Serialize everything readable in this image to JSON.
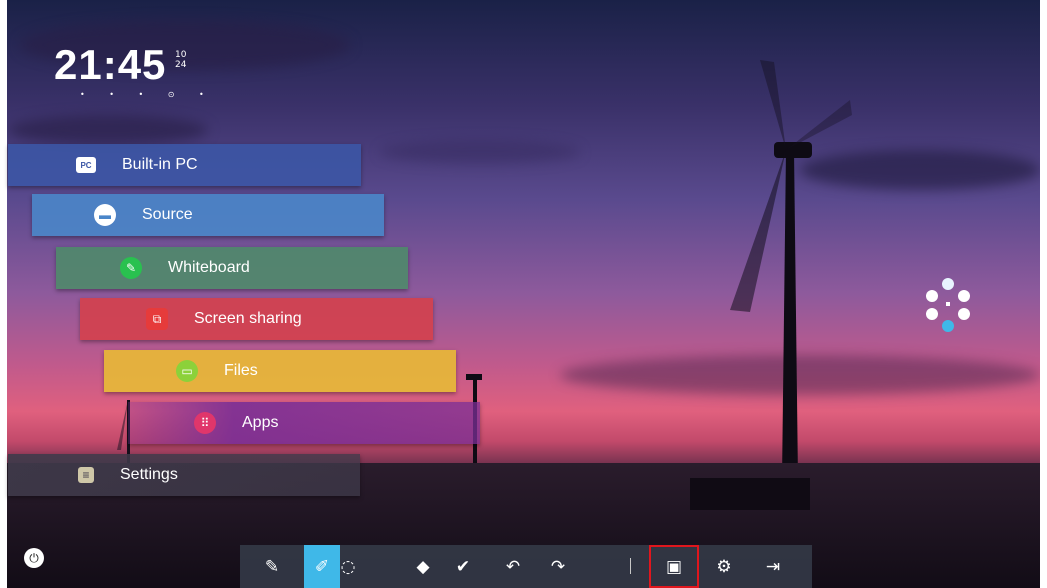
{
  "clock": {
    "time": "21:45",
    "date_top": "10",
    "date_bottom": "24"
  },
  "page_dots": "• • • ⊙ •",
  "menu": [
    {
      "label": "Built-in PC",
      "icon": "pc-icon"
    },
    {
      "label": "Source",
      "icon": "source-icon"
    },
    {
      "label": "Whiteboard",
      "icon": "whiteboard-icon"
    },
    {
      "label": "Screen sharing",
      "icon": "screen-sharing-icon"
    },
    {
      "label": "Files",
      "icon": "files-icon"
    },
    {
      "label": "Apps",
      "icon": "apps-icon"
    },
    {
      "label": "Settings",
      "icon": "settings-icon"
    }
  ],
  "menu_icon_glyphs": {
    "pc": "PC",
    "source": "▬",
    "whiteboard": "✎",
    "screen": "⧉",
    "files": "▭",
    "apps": "⠿",
    "settings": "≡"
  },
  "colors": {
    "built_in_pc": "#3b57a6",
    "source": "#4a86c9",
    "whiteboard": "#4f8a6a",
    "screen_sharing": "#d2414e",
    "files": "#e6b53a",
    "apps": "#7a2e95",
    "settings": "#3f3a4a",
    "toolbar_active": "#3fb8e8",
    "selection_outline": "#e0161d"
  },
  "toolbar": {
    "tools": [
      {
        "name": "pen",
        "glyph": "✎"
      },
      {
        "name": "highlighter",
        "glyph": "✐"
      },
      {
        "name": "lasso",
        "glyph": "◌"
      },
      {
        "name": "eraser",
        "glyph": "◆"
      },
      {
        "name": "check",
        "glyph": "✔"
      },
      {
        "name": "undo",
        "glyph": "↶"
      },
      {
        "name": "redo",
        "glyph": "↷"
      },
      {
        "name": "screenshot",
        "glyph": "▣"
      },
      {
        "name": "settings",
        "glyph": "⚙"
      },
      {
        "name": "exit",
        "glyph": "⇥"
      }
    ],
    "active_tool": "highlighter",
    "selected_tool": "screenshot"
  },
  "power_glyph": "⏻"
}
